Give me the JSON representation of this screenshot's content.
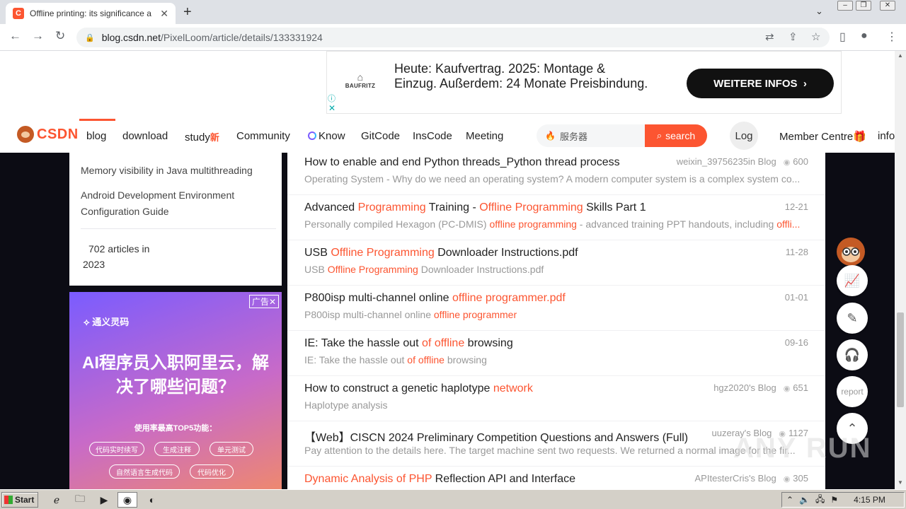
{
  "browser": {
    "tab_title": "Offline printing: its significance and i",
    "tab_favicon_letter": "C",
    "url_host": "blog.csdn.net",
    "url_path": "/PixelLoom/article/details/133331924"
  },
  "ad_banner": {
    "brand": "BAUFRITZ",
    "text": "Heute: Kaufvertrag. 2025: Montage & Einzug. Außerdem: 24 Monate Preisbindung.",
    "cta": "WEITERE INFOS"
  },
  "nav": {
    "logo": "CSDN",
    "items": [
      "blog",
      "download",
      "study",
      "Community",
      "Know",
      "GitCode",
      "InsCode",
      "Meeting"
    ],
    "study_badge": "新",
    "search_placeholder": "服务器",
    "search_button": "search",
    "login": "Log",
    "member": "Member Centre",
    "info": "info"
  },
  "sidebar": {
    "links": [
      "Memory visibility in Java multithreading",
      "Android Development Environment Configuration Guide"
    ],
    "archive": "702 articles in 2023"
  },
  "side_ad": {
    "tag": "广告",
    "brand": "通义灵码",
    "headline": "AI程序员入职阿里云，解决了哪些问题？",
    "sub": "使用率最高TOP5功能：",
    "pills": [
      "代码实时续写",
      "生成注释",
      "单元测试",
      "自然语言生成代码",
      "代码优化"
    ]
  },
  "articles": [
    {
      "title_parts": [
        {
          "t": "How to enable and end Python threads_Python thread process",
          "h": false
        }
      ],
      "desc_parts": [
        {
          "t": "Operating System - Why do we need an operating system? A modern computer system is a complex system co...",
          "h": false
        }
      ],
      "meta": "weixin_39756235in Blog",
      "views": "600"
    },
    {
      "title_parts": [
        {
          "t": "Advanced ",
          "h": false
        },
        {
          "t": "Programming",
          "h": true
        },
        {
          "t": " Training - ",
          "h": false
        },
        {
          "t": "Offline Programming",
          "h": true
        },
        {
          "t": " Skills Part 1",
          "h": false
        }
      ],
      "desc_parts": [
        {
          "t": "Personally compiled Hexagon (PC-DMIS) ",
          "h": false
        },
        {
          "t": "offline programming",
          "h": true
        },
        {
          "t": " - advanced training PPT handouts, including ",
          "h": false
        },
        {
          "t": "offli...",
          "h": true
        }
      ],
      "meta": "12-21",
      "views": ""
    },
    {
      "title_parts": [
        {
          "t": "USB ",
          "h": false
        },
        {
          "t": "Offline Programming",
          "h": true
        },
        {
          "t": " Downloader Instructions.pdf",
          "h": false
        }
      ],
      "desc_parts": [
        {
          "t": "USB ",
          "h": false
        },
        {
          "t": "Offline Programming",
          "h": true
        },
        {
          "t": " Downloader Instructions.pdf",
          "h": false
        }
      ],
      "meta": "11-28",
      "views": ""
    },
    {
      "title_parts": [
        {
          "t": "P800isp multi-channel online ",
          "h": false
        },
        {
          "t": "offline programmer.pdf",
          "h": true
        }
      ],
      "desc_parts": [
        {
          "t": "P800isp multi-channel online ",
          "h": false
        },
        {
          "t": "offline programmer",
          "h": true
        }
      ],
      "meta": "01-01",
      "views": ""
    },
    {
      "title_parts": [
        {
          "t": "IE: Take the hassle out ",
          "h": false
        },
        {
          "t": "of offline",
          "h": true
        },
        {
          "t": " browsing",
          "h": false
        }
      ],
      "desc_parts": [
        {
          "t": "IE: Take the hassle out ",
          "h": false
        },
        {
          "t": "of offline",
          "h": true
        },
        {
          "t": " browsing",
          "h": false
        }
      ],
      "meta": "09-16",
      "views": ""
    },
    {
      "title_parts": [
        {
          "t": "How to construct a genetic haplotype ",
          "h": false
        },
        {
          "t": "network",
          "h": true
        }
      ],
      "desc_parts": [
        {
          "t": "Haplotype analysis",
          "h": false
        }
      ],
      "meta": "hgz2020's Blog",
      "views": "651"
    },
    {
      "title_parts": [
        {
          "t": "【Web】CISCN 2024 Preliminary Competition Questions and Answers (Full)",
          "h": false
        }
      ],
      "desc_parts": [
        {
          "t": "Pay attention to the details here. The target machine sent two requests. We returned a normal image for the fir...",
          "h": false
        }
      ],
      "meta": "uuzeray's Blog",
      "views": "1127"
    },
    {
      "title_parts": [
        {
          "t": "Dynamic Analysis of PHP",
          "h": true
        },
        {
          "t": " Reflection API and Interface",
          "h": false
        }
      ],
      "desc_parts": [],
      "meta": "APItesterCris's Blog",
      "views": "305"
    }
  ],
  "float_tools": {
    "report": "report"
  },
  "watermark": "ANY RUN",
  "taskbar": {
    "start": "Start",
    "time": "4:15 PM"
  },
  "colors": {
    "accent": "#fc5531",
    "page_bg": "#0c0c14"
  }
}
